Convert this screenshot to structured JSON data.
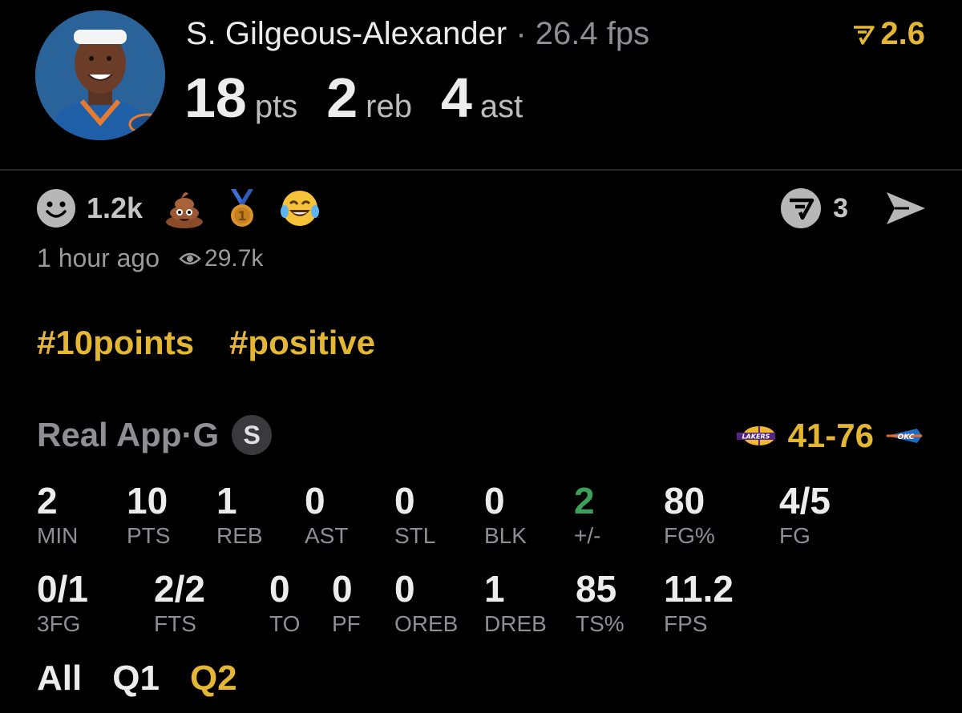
{
  "header": {
    "player_name": "S. Gilgeous-Alexander",
    "separator": " · ",
    "fps": "26.4 fps",
    "badge_value": "2.6",
    "stats": [
      {
        "value": "18",
        "unit": "pts"
      },
      {
        "value": "2",
        "unit": "reb"
      },
      {
        "value": "4",
        "unit": "ast"
      }
    ]
  },
  "reactions": {
    "count": "1.2k",
    "emoji_icons": [
      "smiley-icon",
      "poop-emoji-icon",
      "medal-emoji-icon",
      "laughing-tears-emoji-icon"
    ],
    "comment_count": "3"
  },
  "meta": {
    "time_ago": "1 hour ago",
    "views": "29.7k"
  },
  "hashtags": [
    "#10points",
    "#positive"
  ],
  "game": {
    "source": "Real App",
    "dot": " · ",
    "position": "G",
    "s_badge": "S",
    "score": "41-76",
    "home_team_logo": "lakers-logo",
    "away_team_logo": "okc-logo"
  },
  "box_row1": [
    {
      "value": "2",
      "label": "MIN"
    },
    {
      "value": "10",
      "label": "PTS"
    },
    {
      "value": "1",
      "label": "REB"
    },
    {
      "value": "0",
      "label": "AST"
    },
    {
      "value": "0",
      "label": "STL"
    },
    {
      "value": "0",
      "label": "BLK"
    },
    {
      "value": "2",
      "label": "+/-"
    },
    {
      "value": "80",
      "label": "FG%"
    },
    {
      "value": "4/5",
      "label": "FG"
    }
  ],
  "box_row2": [
    {
      "value": "0/1",
      "label": "3FG"
    },
    {
      "value": "2/2",
      "label": "FTS"
    },
    {
      "value": "0",
      "label": "TO"
    },
    {
      "value": "0",
      "label": "PF"
    },
    {
      "value": "0",
      "label": "OREB"
    },
    {
      "value": "1",
      "label": "DREB"
    },
    {
      "value": "85",
      "label": "TS%"
    },
    {
      "value": "11.2",
      "label": "FPS"
    }
  ],
  "quarters": [
    "All",
    "Q1",
    "Q2"
  ],
  "colors": {
    "accent": "#e3b634",
    "positive": "#3aa05a",
    "muted": "#8e8e93"
  }
}
